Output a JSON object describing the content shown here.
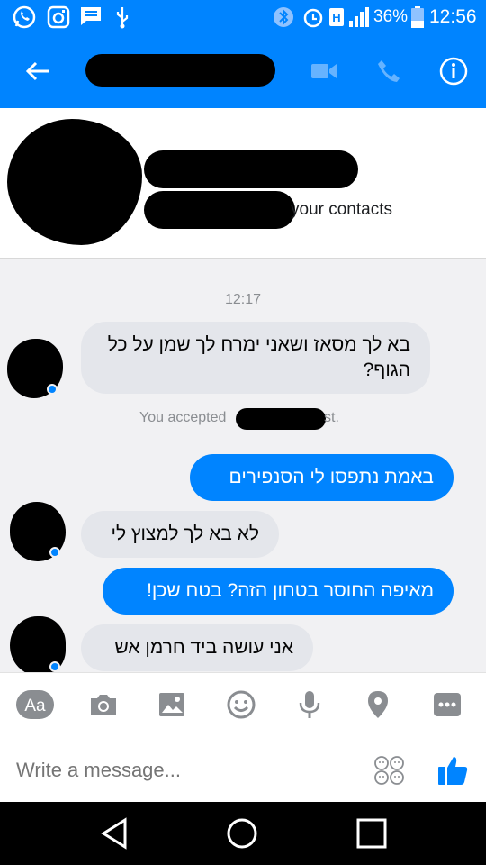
{
  "status_bar": {
    "battery_percent": "36%",
    "time": "12:56",
    "icons": [
      "whatsapp-icon",
      "instagram-icon",
      "message-icon",
      "usb-icon",
      "bluetooth-icon",
      "alarm-icon",
      "data-icon",
      "signal-icon",
      "battery-icon"
    ]
  },
  "header": {
    "icons": [
      "back-arrow-icon",
      "video-call-icon",
      "phone-call-icon",
      "info-icon"
    ]
  },
  "contact_card": {
    "subtitle_fragment": "your contacts"
  },
  "chat": {
    "timestamp": "12:17",
    "system_left": "You accepted",
    "system_right": "st.",
    "messages": [
      {
        "direction": "in",
        "text": "בא לך מסאז ושאני ימרח לך שמן על כל הגוף?"
      },
      {
        "direction": "out",
        "text": "באמת נתפסו לי הסנפירים"
      },
      {
        "direction": "in",
        "text": "לא בא לך למצוץ לי"
      },
      {
        "direction": "out",
        "text": "מאיפה החוסר בטחון הזה? בטח שכן!"
      },
      {
        "direction": "in",
        "text": "אני עושה ביד חרמן אש"
      }
    ]
  },
  "composer": {
    "aa_label": "Aa",
    "placeholder": "Write a message...",
    "icons": [
      "aa-icon",
      "camera-icon",
      "gallery-icon",
      "smiley-icon",
      "microphone-icon",
      "location-icon",
      "more-icon",
      "emoji-faces-icon",
      "like-icon"
    ]
  },
  "nav_bar": {
    "icons": [
      "back-triangle-icon",
      "home-circle-icon",
      "recents-square-icon"
    ]
  },
  "colors": {
    "brand": "#0084ff",
    "incoming_bubble": "#e4e6eb",
    "chat_background": "#f1f1f3"
  }
}
